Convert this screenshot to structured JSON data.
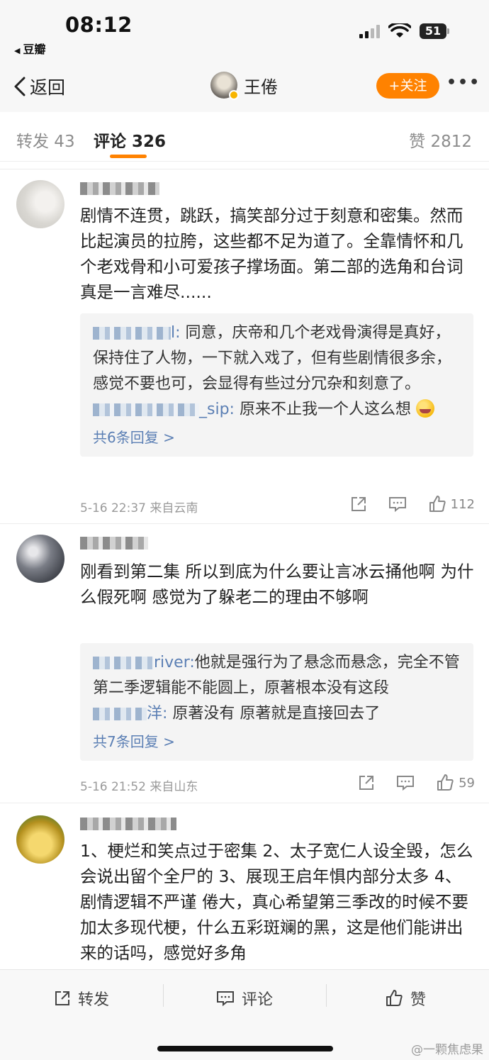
{
  "status_bar": {
    "time": "08:12",
    "back_app": "豆瓣",
    "battery": "51"
  },
  "nav": {
    "back_label": "返回",
    "user_name": "王倦",
    "follow_label": "+关注",
    "more_label": "•••"
  },
  "tabs": {
    "repost": "转发 43",
    "comment": "评论 326",
    "like": "赞 2812"
  },
  "comments": [
    {
      "text": "剧情不连贯，跳跃，搞笑部分过于刻意和密集。然而比起演员的拉胯，这些都不足为道了。全靠情怀和几个老戏骨和小可爱孩子撑场面。第二部的选角和台词真是一言难尽......",
      "replies": [
        {
          "name_tail": "l:",
          "text": "同意，庆帝和几个老戏骨演得是真好，保持住了人物，一下就入戏了，但有些剧情很多余，感觉不要也可，会显得有些过分冗杂和刻意了。"
        },
        {
          "name_tail": "_sip:",
          "text": "原来不止我一个人这么想"
        }
      ],
      "reply_more": "共6条回复 >",
      "meta": "5-16 22:37  来自云南",
      "likes": "112"
    },
    {
      "text": "刚看到第二集 所以到底为什么要让言冰云捅他啊 为什么假死啊  感觉为了躲老二的理由不够啊",
      "replies": [
        {
          "name_tail": "river:",
          "text": "他就是强行为了悬念而悬念，完全不管第二季逻辑能不能圆上，原著根本没有这段"
        },
        {
          "name_tail": "洋:",
          "text": "原著没有  原著就是直接回去了"
        }
      ],
      "reply_more": "共7条回复 >",
      "meta": "5-16 21:52  来自山东",
      "likes": "59"
    },
    {
      "text": "1、梗烂和笑点过于密集 2、太子宽仁人设全毁，怎么会说出留个全尸的 3、展现王启年惧内部分太多 4、剧情逻辑不严谨 倦大，真心希望第三季改的时候不要加太多现代梗，什么五彩斑斓的黑，这是他们能讲出来的话吗，感觉好多角"
    }
  ],
  "bottom_bar": {
    "repost": "转发",
    "comment": "评论",
    "like": "赞",
    "watermark": "@一颗焦虑果"
  },
  "colors": {
    "accent": "#ff8200",
    "link": "#5b7fb4",
    "bar_bg": "#f7f7f7"
  }
}
